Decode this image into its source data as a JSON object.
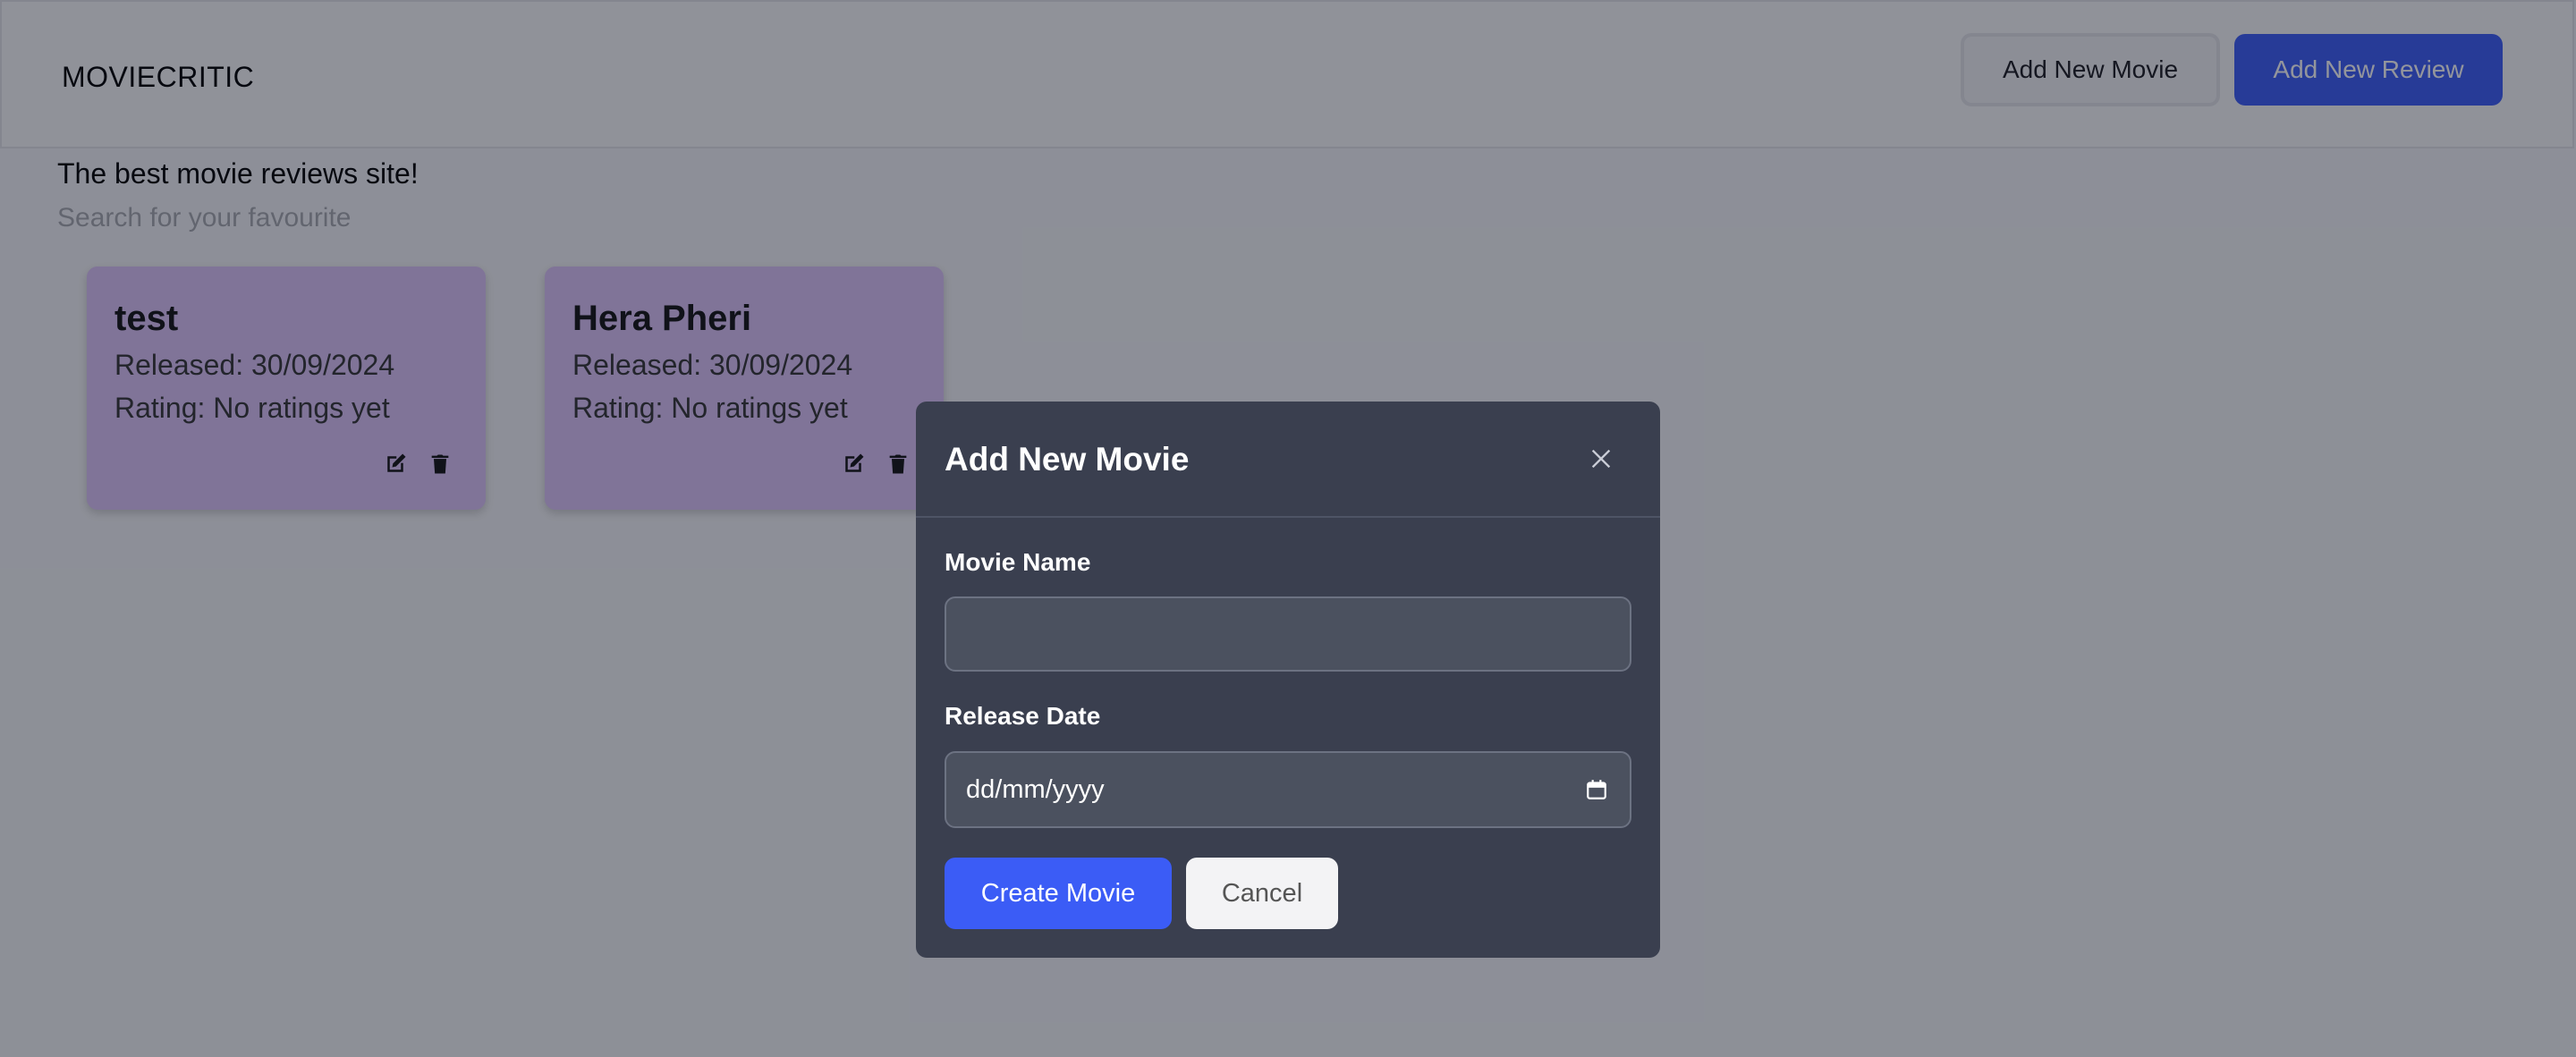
{
  "header": {
    "brand": "MOVIECRITIC",
    "add_movie_label": "Add New Movie",
    "add_review_label": "Add New Review"
  },
  "main": {
    "tagline": "The best movie reviews site!",
    "search_placeholder": "Search for your favourite",
    "cards": [
      {
        "title": "test",
        "released": "Released: 30/09/2024",
        "rating": "Rating: No ratings yet"
      },
      {
        "title": "Hera Pheri",
        "released": "Released: 30/09/2024",
        "rating": "Rating: No ratings yet"
      }
    ]
  },
  "modal": {
    "title": "Add New Movie",
    "movie_name_label": "Movie Name",
    "movie_name_value": "",
    "release_date_label": "Release Date",
    "release_date_placeholder": "dd/mm/yyyy",
    "create_label": "Create Movie",
    "cancel_label": "Cancel"
  },
  "colors": {
    "primary": "#3b5cf6",
    "card_bg": "#ddc3f7",
    "modal_bg": "#3a3f4f",
    "overlay": "rgba(15,20,35,0.45)"
  },
  "icons": {
    "card_edit": "edit-icon",
    "card_delete": "trash-icon",
    "modal_close": "close-icon",
    "date_picker": "calendar-icon"
  }
}
